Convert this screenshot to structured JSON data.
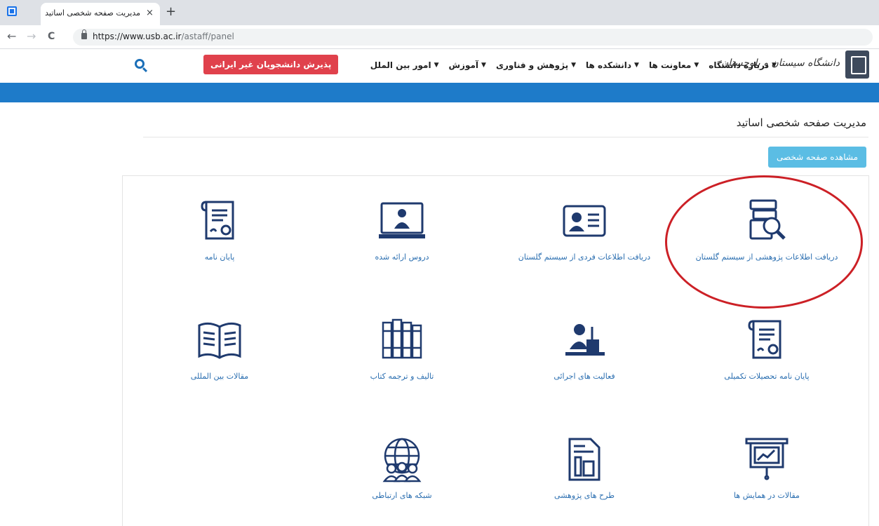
{
  "browser": {
    "tab_title": "مدیریت صفحه شخصی اساتید",
    "tab_close": "×",
    "new_tab": "+",
    "url_main": "https://www.usb.ac.ir",
    "url_path": "/astaff/panel",
    "back": "←",
    "forward": "→",
    "reload": "C"
  },
  "header": {
    "logo_text": "دانشگاه سیستان و بلوچستان",
    "nav": [
      "درباره دانشگاه",
      "معاونت ها",
      "دانشکده ها",
      "پژوهش و فناوری",
      "آموزش",
      "امور بین الملل"
    ],
    "foreign_button": "پذیرش دانشجویان غیر ایرانی",
    "accent_color": "#1e7bc9",
    "button_color": "#e0414c"
  },
  "page": {
    "title": "مدیریت صفحه شخصی اساتید",
    "profile_button": "مشاهده صفحه شخصی"
  },
  "cards": [
    {
      "label": "دریافت اطلاعات پژوهشی از سیستم گلستان",
      "icon": "research-search-icon"
    },
    {
      "label": "دریافت اطلاعات فردی از سیستم گلستان",
      "icon": "id-card-icon"
    },
    {
      "label": "دروس ارائه شده",
      "icon": "online-teacher-icon"
    },
    {
      "label": "پایان نامه",
      "icon": "certificate-icon"
    },
    {
      "label": "پایان نامه تحصیلات تکمیلی",
      "icon": "certificate-icon"
    },
    {
      "label": "فعالیت های اجرائی",
      "icon": "speaker-podium-icon"
    },
    {
      "label": "تالیف و ترجمه کتاب",
      "icon": "bookshelf-icon"
    },
    {
      "label": "مقالات بین المللی",
      "icon": "open-book-icon"
    },
    {
      "label": "مقالات در همایش ها",
      "icon": "presentation-board-icon"
    },
    {
      "label": "طرح های پژوهشی",
      "icon": "project-document-icon"
    },
    {
      "label": "شبکه های ارتباطی",
      "icon": "global-network-icon"
    }
  ]
}
